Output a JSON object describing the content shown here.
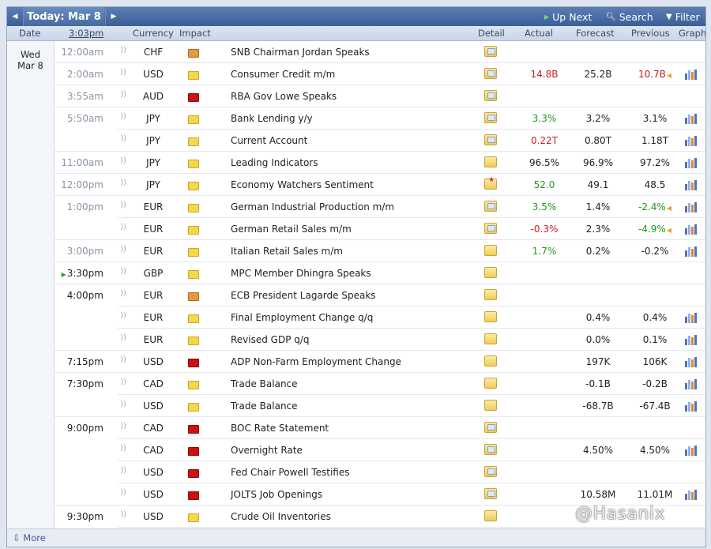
{
  "toolbar": {
    "prev_icon": "◀",
    "title": "Today: Mar 8",
    "next_icon": "▶",
    "up_next": "Up Next",
    "search": "Search",
    "filter": "Filter"
  },
  "columns": {
    "date": "Date",
    "time": "3:03pm",
    "currency": "Currency",
    "impact": "Impact",
    "detail": "Detail",
    "actual": "Actual",
    "forecast": "Forecast",
    "previous": "Previous",
    "graph": "Graph"
  },
  "date": {
    "weekday": "Wed",
    "day": "Mar 8"
  },
  "events": [
    {
      "time": "12:00am",
      "time_state": "past",
      "currency": "CHF",
      "impact": "medium",
      "event": "SNB Chairman Jordan Speaks",
      "detail": "doc",
      "actual": "",
      "actual_color": "",
      "forecast": "",
      "previous": "",
      "previous_color": "",
      "revised": false,
      "graph": false
    },
    {
      "time": "2:00am",
      "time_state": "past",
      "currency": "USD",
      "impact": "low",
      "event": "Consumer Credit m/m",
      "detail": "doc",
      "actual": "14.8B",
      "actual_color": "red",
      "forecast": "25.2B",
      "previous": "10.7B",
      "previous_color": "red",
      "revised": true,
      "graph": true
    },
    {
      "time": "3:55am",
      "time_state": "past",
      "currency": "AUD",
      "impact": "high",
      "event": "RBA Gov Lowe Speaks",
      "detail": "doc",
      "actual": "",
      "actual_color": "",
      "forecast": "",
      "previous": "",
      "previous_color": "",
      "revised": false,
      "graph": false
    },
    {
      "time": "5:50am",
      "time_state": "past",
      "currency": "JPY",
      "impact": "low",
      "event": "Bank Lending y/y",
      "detail": "doc",
      "actual": "3.3%",
      "actual_color": "green",
      "forecast": "3.2%",
      "previous": "3.1%",
      "previous_color": "",
      "revised": false,
      "graph": true
    },
    {
      "time": "",
      "time_state": "past",
      "currency": "JPY",
      "impact": "low",
      "event": "Current Account",
      "detail": "doc",
      "actual": "0.22T",
      "actual_color": "red",
      "forecast": "0.80T",
      "previous": "1.18T",
      "previous_color": "",
      "revised": false,
      "graph": true
    },
    {
      "time": "11:00am",
      "time_state": "past",
      "currency": "JPY",
      "impact": "low",
      "event": "Leading Indicators",
      "detail": "plain",
      "actual": "96.5%",
      "actual_color": "",
      "forecast": "96.9%",
      "previous": "97.2%",
      "previous_color": "",
      "revised": false,
      "graph": true
    },
    {
      "time": "12:00pm",
      "time_state": "past",
      "currency": "JPY",
      "impact": "low",
      "event": "Economy Watchers Sentiment",
      "detail": "star",
      "actual": "52.0",
      "actual_color": "green",
      "forecast": "49.1",
      "previous": "48.5",
      "previous_color": "",
      "revised": false,
      "graph": true
    },
    {
      "time": "1:00pm",
      "time_state": "past",
      "currency": "EUR",
      "impact": "low",
      "event": "German Industrial Production m/m",
      "detail": "doc",
      "actual": "3.5%",
      "actual_color": "green",
      "forecast": "1.4%",
      "previous": "-2.4%",
      "previous_color": "green",
      "revised": true,
      "graph": true
    },
    {
      "time": "",
      "time_state": "past",
      "currency": "EUR",
      "impact": "low",
      "event": "German Retail Sales m/m",
      "detail": "doc",
      "actual": "-0.3%",
      "actual_color": "red",
      "forecast": "2.3%",
      "previous": "-4.9%",
      "previous_color": "green",
      "revised": true,
      "graph": true
    },
    {
      "time": "3:00pm",
      "time_state": "past",
      "currency": "EUR",
      "impact": "low",
      "event": "Italian Retail Sales m/m",
      "detail": "plain",
      "actual": "1.7%",
      "actual_color": "green",
      "forecast": "0.2%",
      "previous": "-0.2%",
      "previous_color": "",
      "revised": false,
      "graph": true
    },
    {
      "time": "3:30pm",
      "time_state": "current",
      "currency": "GBP",
      "impact": "low",
      "event": "MPC Member Dhingra Speaks",
      "detail": "plain",
      "actual": "",
      "actual_color": "",
      "forecast": "",
      "previous": "",
      "previous_color": "",
      "revised": false,
      "graph": false
    },
    {
      "time": "4:00pm",
      "time_state": "future",
      "currency": "EUR",
      "impact": "medium",
      "event": "ECB President Lagarde Speaks",
      "detail": "plain",
      "actual": "",
      "actual_color": "",
      "forecast": "",
      "previous": "",
      "previous_color": "",
      "revised": false,
      "graph": false
    },
    {
      "time": "",
      "time_state": "future",
      "currency": "EUR",
      "impact": "low",
      "event": "Final Employment Change q/q",
      "detail": "plain",
      "actual": "",
      "actual_color": "",
      "forecast": "0.4%",
      "previous": "0.4%",
      "previous_color": "",
      "revised": false,
      "graph": true
    },
    {
      "time": "",
      "time_state": "future",
      "currency": "EUR",
      "impact": "low",
      "event": "Revised GDP q/q",
      "detail": "plain",
      "actual": "",
      "actual_color": "",
      "forecast": "0.0%",
      "previous": "0.1%",
      "previous_color": "",
      "revised": false,
      "graph": true
    },
    {
      "time": "7:15pm",
      "time_state": "future",
      "currency": "USD",
      "impact": "high",
      "event": "ADP Non-Farm Employment Change",
      "detail": "plain",
      "actual": "",
      "actual_color": "",
      "forecast": "197K",
      "previous": "106K",
      "previous_color": "",
      "revised": false,
      "graph": true
    },
    {
      "time": "7:30pm",
      "time_state": "future",
      "currency": "CAD",
      "impact": "low",
      "event": "Trade Balance",
      "detail": "plain",
      "actual": "",
      "actual_color": "",
      "forecast": "-0.1B",
      "previous": "-0.2B",
      "previous_color": "",
      "revised": false,
      "graph": true
    },
    {
      "time": "",
      "time_state": "future",
      "currency": "USD",
      "impact": "low",
      "event": "Trade Balance",
      "detail": "plain",
      "actual": "",
      "actual_color": "",
      "forecast": "-68.7B",
      "previous": "-67.4B",
      "previous_color": "",
      "revised": false,
      "graph": true
    },
    {
      "time": "9:00pm",
      "time_state": "future",
      "currency": "CAD",
      "impact": "high",
      "event": "BOC Rate Statement",
      "detail": "doc",
      "actual": "",
      "actual_color": "",
      "forecast": "",
      "previous": "",
      "previous_color": "",
      "revised": false,
      "graph": false
    },
    {
      "time": "",
      "time_state": "future",
      "currency": "CAD",
      "impact": "high",
      "event": "Overnight Rate",
      "detail": "doc",
      "actual": "",
      "actual_color": "",
      "forecast": "4.50%",
      "previous": "4.50%",
      "previous_color": "",
      "revised": false,
      "graph": true
    },
    {
      "time": "",
      "time_state": "future",
      "currency": "USD",
      "impact": "high",
      "event": "Fed Chair Powell Testifies",
      "detail": "doc",
      "actual": "",
      "actual_color": "",
      "forecast": "",
      "previous": "",
      "previous_color": "",
      "revised": false,
      "graph": false
    },
    {
      "time": "",
      "time_state": "future",
      "currency": "USD",
      "impact": "high",
      "event": "JOLTS Job Openings",
      "detail": "doc",
      "actual": "",
      "actual_color": "",
      "forecast": "10.58M",
      "previous": "11.01M",
      "previous_color": "",
      "revised": false,
      "graph": true
    },
    {
      "time": "9:30pm",
      "time_state": "future",
      "currency": "USD",
      "impact": "low",
      "event": "Crude Oil Inventories",
      "detail": "plain",
      "actual": "",
      "actual_color": "",
      "forecast": "",
      "previous": "",
      "previous_color": "",
      "revised": false,
      "graph": false
    }
  ],
  "footer": {
    "more_icon": "⇩",
    "more": "More"
  },
  "watermark": "@Hasanix",
  "colors": {
    "toolbar": "#3a5e97",
    "actual_better": "#1f9a1f",
    "actual_worse": "#c81e1e",
    "high_impact": "#cc1111",
    "medium_impact": "#e39a3e",
    "low_impact": "#f5d84a"
  }
}
